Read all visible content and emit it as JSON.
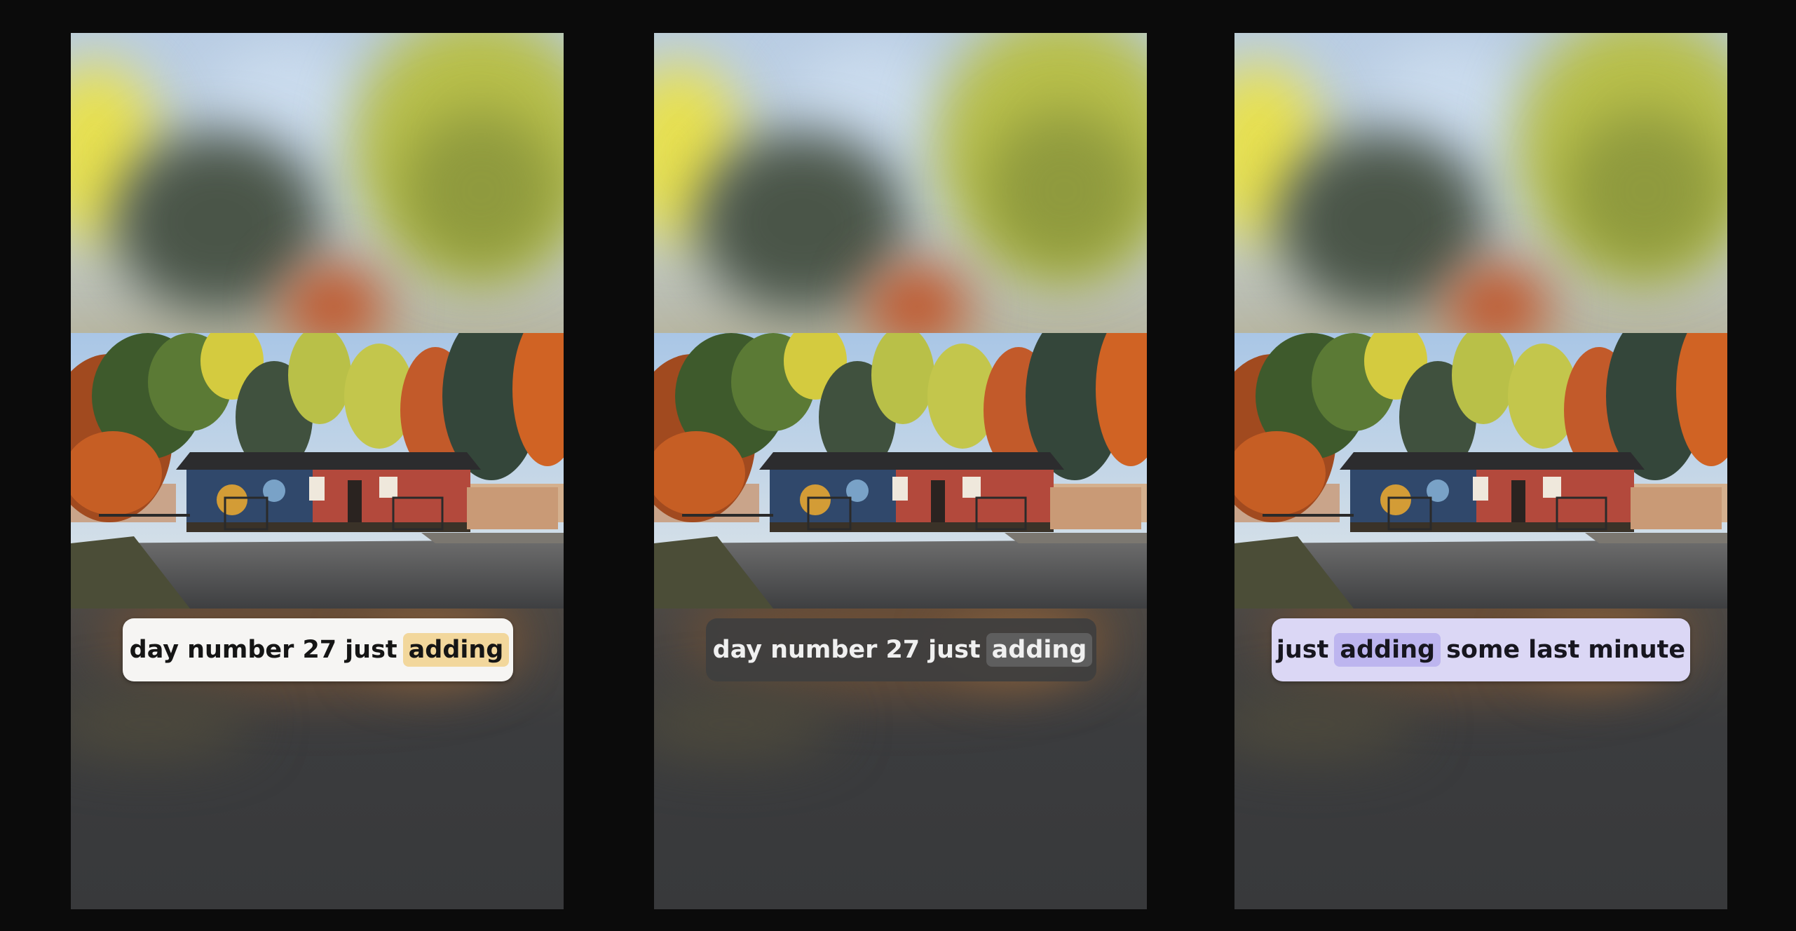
{
  "panels": [
    {
      "id": "style-1",
      "caption": {
        "before_1": "day",
        "before_2": "number",
        "before_3": "27",
        "before_4": "just",
        "highlight": "adding",
        "after": ""
      },
      "colors": {
        "pill_bg": "#f6f5f3",
        "text": "#151515",
        "highlight_bg": "#f2d79c"
      }
    },
    {
      "id": "style-2",
      "caption": {
        "before_1": "day",
        "before_2": "number",
        "before_3": "27",
        "before_4": "just",
        "highlight": "adding",
        "after": ""
      },
      "colors": {
        "pill_bg": "#3e3e3e",
        "text": "#f0f0f0",
        "highlight_bg": "#5e5e5e"
      }
    },
    {
      "id": "style-3",
      "caption": {
        "before_1": "just",
        "highlight": "adding",
        "after_1": "some",
        "after_2": "last",
        "after_3": "minute"
      },
      "colors": {
        "pill_bg": "#dbd7f5",
        "text": "#17161f",
        "highlight_bg": "#bdb5ef"
      }
    }
  ],
  "scene": {
    "description_icon": "autumn-house-scene",
    "palette": {
      "sky": "#bcd3ea",
      "foliage_orange": "#c9581f",
      "foliage_yellow": "#c9c53a",
      "foliage_green": "#3f5b2e",
      "house_red": "#b8463a",
      "house_mural": "#2f4f7a",
      "road": "#55565a"
    }
  }
}
